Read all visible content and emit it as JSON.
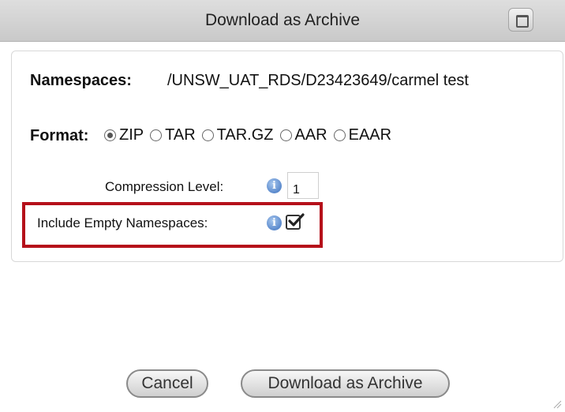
{
  "dialog": {
    "title": "Download as Archive"
  },
  "namespaces": {
    "label": "Namespaces:",
    "value": "/UNSW_UAT_RDS/D23423649/carmel test"
  },
  "format": {
    "label": "Format:",
    "selected": "ZIP",
    "options": [
      "ZIP",
      "TAR",
      "TAR.GZ",
      "AAR",
      "EAAR"
    ]
  },
  "compression": {
    "label": "Compression Level:",
    "value": "1"
  },
  "include_empty": {
    "label": "Include Empty Namespaces:",
    "checked": true,
    "highlight_color": "#b5101a"
  },
  "buttons": {
    "cancel": "Cancel",
    "download": "Download as Archive"
  },
  "icons": {
    "maximize": "maximize-icon",
    "info": "info-icon",
    "check": "checkmark-icon",
    "resize": "resize-grip-icon"
  }
}
